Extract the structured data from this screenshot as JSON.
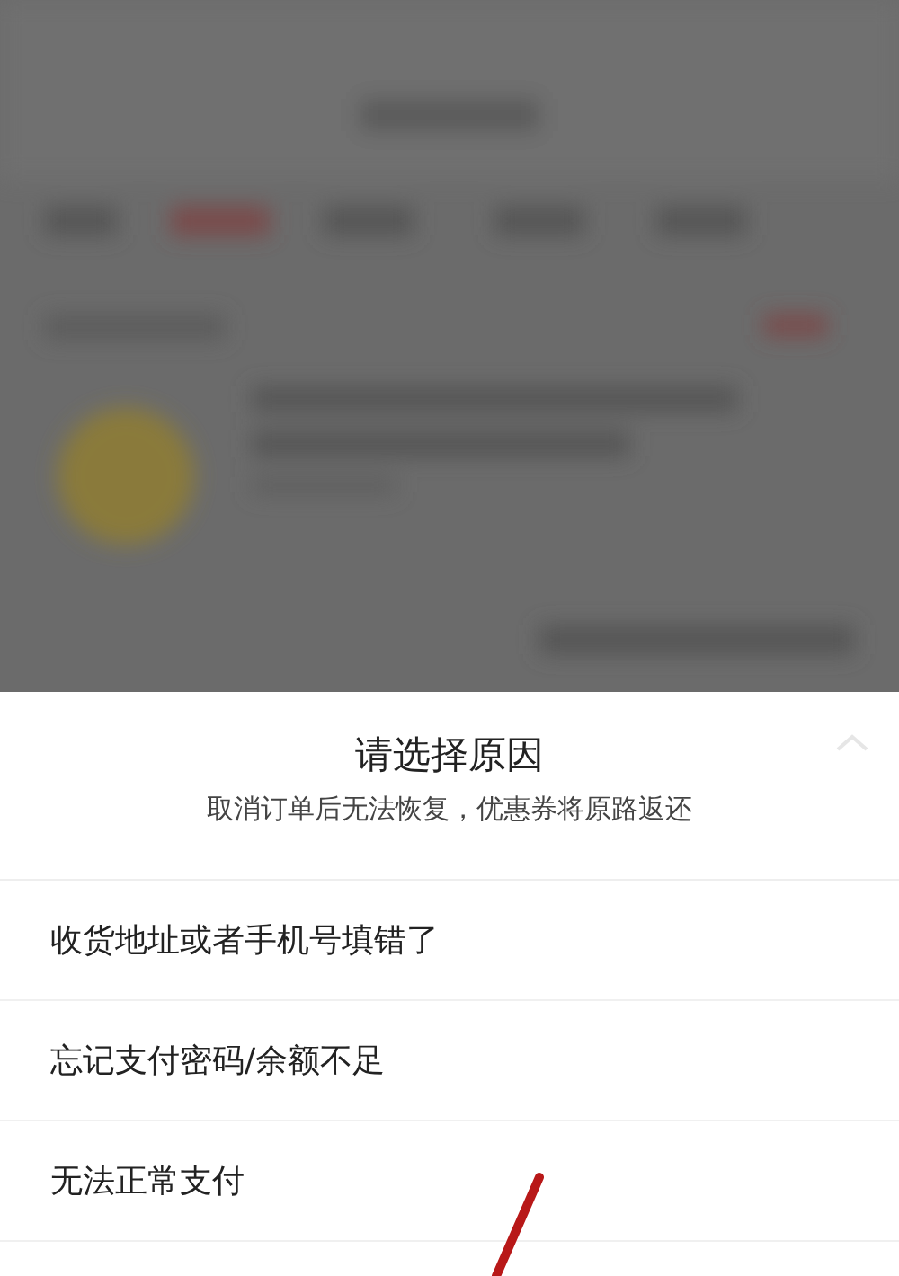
{
  "sheet": {
    "title": "请选择原因",
    "subtitle": "取消订单后无法恢复，优惠券将原路返还"
  },
  "reasons": [
    {
      "label": "收货地址或者手机号填错了"
    },
    {
      "label": "忘记支付密码/余额不足"
    },
    {
      "label": "无法正常支付"
    }
  ]
}
